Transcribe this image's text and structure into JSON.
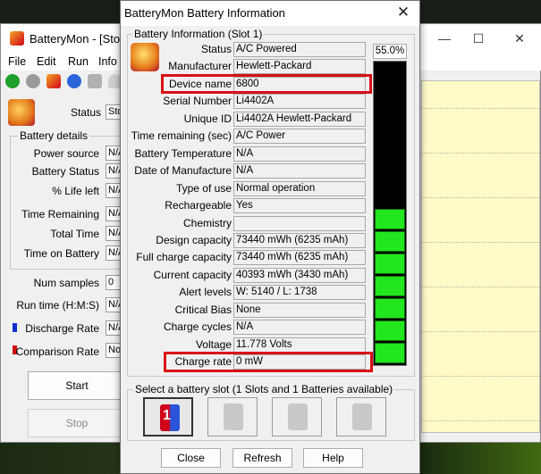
{
  "main": {
    "title": "BatteryMon - [Stopp",
    "window_controls": {
      "minimize": "—",
      "maximize": "☐",
      "close": "✕"
    },
    "menu": [
      "File",
      "Edit",
      "Run",
      "Info"
    ],
    "status_label": "Status",
    "status_value": "Sto",
    "battery_details_title": "Battery details",
    "details": [
      {
        "label": "Power source",
        "value": "N/A"
      },
      {
        "label": "Battery Status",
        "value": "N/A"
      },
      {
        "label": "% Life left",
        "value": "N/A"
      },
      {
        "label": "Time Remaining",
        "value": "N/A"
      },
      {
        "label": "Total Time",
        "value": "N/A"
      },
      {
        "label": "Time on Battery",
        "value": "N/A"
      }
    ],
    "num_samples_label": "Num samples",
    "num_samples_value": "0",
    "run_time_label": "Run time (H:M:S)",
    "run_time_value": "N/A",
    "discharge_rate_label": "Discharge Rate",
    "discharge_rate_value": "N/A",
    "comparison_rate_label": "Comparison Rate",
    "comparison_rate_value": "No",
    "start_label": "Start",
    "stop_label": "Stop",
    "colors": {
      "discharge": "#1030d0",
      "comparison": "#d01010"
    }
  },
  "dialog": {
    "title": "BatteryMon Battery Information",
    "close_glyph": "✕",
    "group_title": "Battery Information (Slot 1)",
    "charge_percent": "55.0%",
    "charge_fraction": 0.55,
    "rows": [
      {
        "label": "Status",
        "value": "A/C Powered"
      },
      {
        "label": "Manufacturer",
        "value": "Hewlett-Packard"
      },
      {
        "label": "Device name",
        "value": "6800"
      },
      {
        "label": "Serial Number",
        "value": "Li4402A"
      },
      {
        "label": "Unique ID",
        "value": "Li4402A Hewlett-Packard"
      },
      {
        "label": "Time remaining (sec)",
        "value": "A/C Power"
      },
      {
        "label": "Battery Temperature",
        "value": "N/A"
      },
      {
        "label": "Date of Manufacture",
        "value": "N/A"
      },
      {
        "label": "Type of use",
        "value": "Normal operation"
      },
      {
        "label": "Rechargeable",
        "value": "Yes"
      },
      {
        "label": "Chemistry",
        "value": ""
      },
      {
        "label": "Design capacity",
        "value": "73440 mWh (6235 mAh)"
      },
      {
        "label": "Full charge capacity",
        "value": "73440 mWh (6235 mAh)"
      },
      {
        "label": "Current capacity",
        "value": "40393 mWh (3430 mAh)"
      },
      {
        "label": "Alert levels",
        "value": "W: 5140 / L: 1738"
      },
      {
        "label": "Critical Bias",
        "value": "None"
      },
      {
        "label": "Charge cycles",
        "value": "N/A"
      },
      {
        "label": "Voltage",
        "value": "11.778 Volts"
      },
      {
        "label": "Charge rate",
        "value": "0 mW"
      }
    ],
    "slot_group_title": "Select a battery slot (1 Slots and 1 Batteries available)",
    "active_slot_number": "1",
    "buttons": {
      "close": "Close",
      "refresh": "Refresh",
      "help": "Help"
    },
    "highlight_color": "#d90f17",
    "gauge_color": "#22e61e"
  }
}
